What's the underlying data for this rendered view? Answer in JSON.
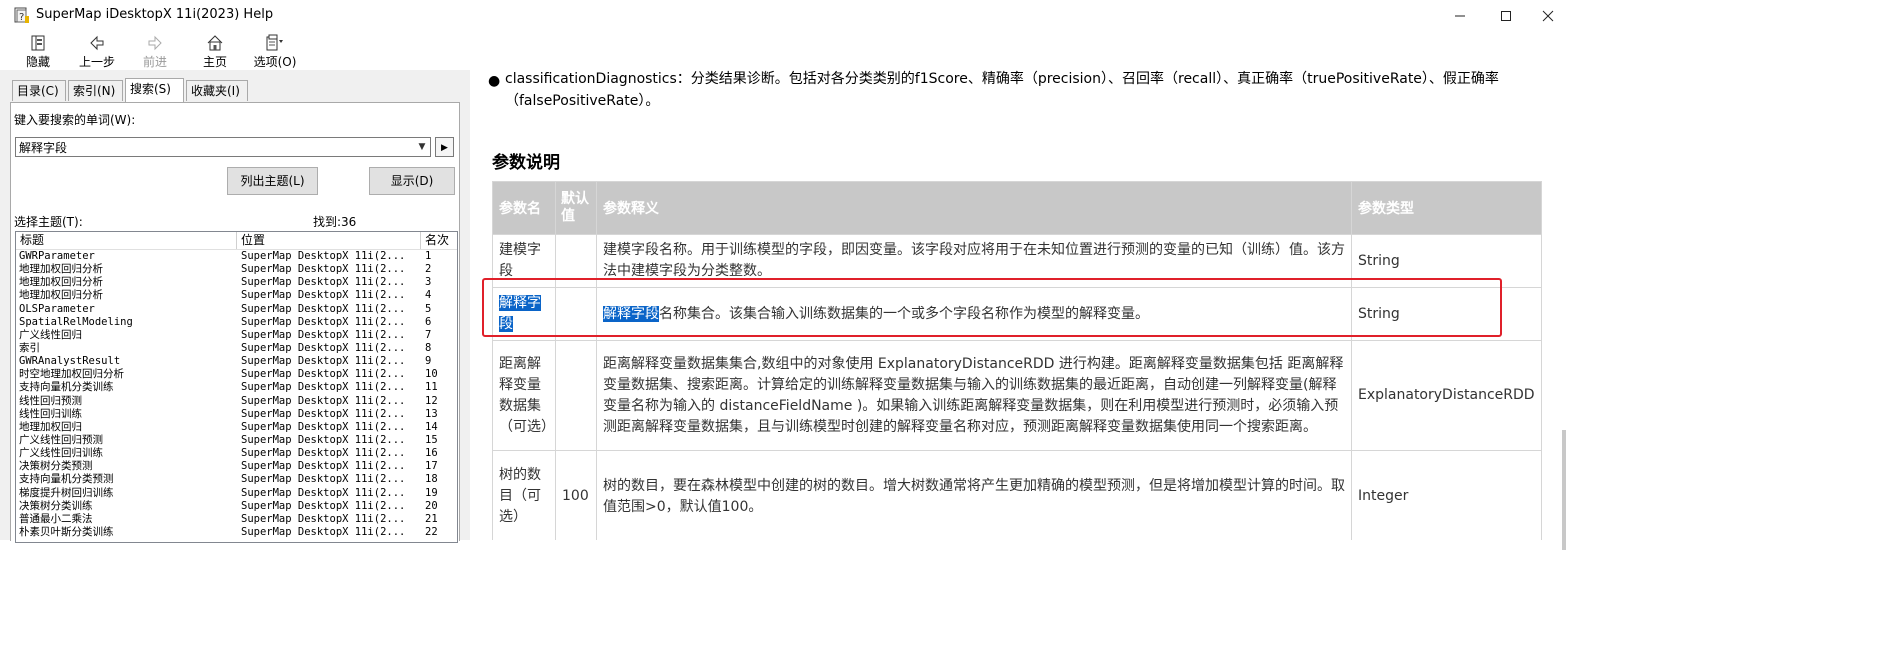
{
  "window": {
    "title": "SuperMap iDesktopX 11i(2023) Help"
  },
  "toolbar": {
    "hide": "隐藏",
    "back": "上一步",
    "forward": "前进",
    "home": "主页",
    "options": "选项(O)"
  },
  "tabs": [
    "目录(C)",
    "索引(N)",
    "搜索(S)",
    "收藏夹(I)"
  ],
  "search": {
    "prompt": "键入要搜索的单词(W):",
    "value": "解释字段",
    "list_topics_button": "列出主题(L)",
    "display_button": "显示(D)",
    "select_topic_label": "选择主题(T):",
    "found_label": "找到:36"
  },
  "results": {
    "columns": [
      "标题",
      "位置",
      "名次"
    ],
    "rows": [
      {
        "title": "GWRParameter",
        "location": "SuperMap DesktopX 11i(2...",
        "rank": "1"
      },
      {
        "title": "地理加权回归分析",
        "location": "SuperMap DesktopX 11i(2...",
        "rank": "2"
      },
      {
        "title": "地理加权回归分析",
        "location": "SuperMap DesktopX 11i(2...",
        "rank": "3"
      },
      {
        "title": "地理加权回归分析",
        "location": "SuperMap DesktopX 11i(2...",
        "rank": "4"
      },
      {
        "title": "OLSParameter",
        "location": "SuperMap DesktopX 11i(2...",
        "rank": "5"
      },
      {
        "title": "SpatialRelModeling",
        "location": "SuperMap DesktopX 11i(2...",
        "rank": "6"
      },
      {
        "title": "广义线性回归",
        "location": "SuperMap DesktopX 11i(2...",
        "rank": "7"
      },
      {
        "title": "索引",
        "location": "SuperMap DesktopX 11i(2...",
        "rank": "8"
      },
      {
        "title": "GWRAnalystResult",
        "location": "SuperMap DesktopX 11i(2...",
        "rank": "9"
      },
      {
        "title": "时空地理加权回归分析",
        "location": "SuperMap DesktopX 11i(2...",
        "rank": "10"
      },
      {
        "title": "支持向量机分类训练",
        "location": "SuperMap DesktopX 11i(2...",
        "rank": "11"
      },
      {
        "title": "线性回归预测",
        "location": "SuperMap DesktopX 11i(2...",
        "rank": "12"
      },
      {
        "title": "线性回归训练",
        "location": "SuperMap DesktopX 11i(2...",
        "rank": "13"
      },
      {
        "title": "地理加权回归",
        "location": "SuperMap DesktopX 11i(2...",
        "rank": "14"
      },
      {
        "title": "广义线性回归预测",
        "location": "SuperMap DesktopX 11i(2...",
        "rank": "15"
      },
      {
        "title": "广义线性回归训练",
        "location": "SuperMap DesktopX 11i(2...",
        "rank": "16"
      },
      {
        "title": "决策树分类预测",
        "location": "SuperMap DesktopX 11i(2...",
        "rank": "17"
      },
      {
        "title": "支持向量机分类预测",
        "location": "SuperMap DesktopX 11i(2...",
        "rank": "18"
      },
      {
        "title": "梯度提升树回归训练",
        "location": "SuperMap DesktopX 11i(2...",
        "rank": "19"
      },
      {
        "title": "决策树分类训练",
        "location": "SuperMap DesktopX 11i(2...",
        "rank": "20"
      },
      {
        "title": "普通最小二乘法",
        "location": "SuperMap DesktopX 11i(2...",
        "rank": "21"
      },
      {
        "title": "朴素贝叶斯分类训练",
        "location": "SuperMap DesktopX 11i(2...",
        "rank": "22"
      }
    ]
  },
  "doc": {
    "bullet_text": "classificationDiagnostics：分类结果诊断。包括对各分类类别的f1Score、精确率（precision）、召回率（recall）、真正确率（truePositiveRate）、假正确率（falsePositiveRate）。",
    "section_title": "参数说明",
    "table_headers": [
      "参数名",
      "默认值",
      "参数释义",
      "参数类型"
    ],
    "rows": [
      {
        "name": "建模字段",
        "default": "",
        "desc": "建模字段名称。用于训练模型的字段，即因变量。该字段对应将用于在未知位置进行预测的变量的已知（训练）值。该方法中建模字段为分类整数。",
        "type": "String"
      },
      {
        "name": "解释字段",
        "default": "",
        "desc_highlight": "解释字段",
        "desc": "名称集合。该集合输入训练数据集的一个或多个字段名称作为模型的解释变量。",
        "type": "String"
      },
      {
        "name": "距离解释变量数据集（可选）",
        "default": "",
        "desc": "距离解释变量数据集集合,数组中的对象使用 ExplanatoryDistanceRDD 进行构建。距离解释变量数据集包括 距离解释变量数据集、搜索距离。计算给定的训练解释变量数据集与输入的训练数据集的最近距离，自动创建一列解释变量(解释变量名称为输入的 distanceFieldName )。如果输入训练距离解释变量数据集，则在利用模型进行预测时，必须输入预测距离解释变量数据集，且与训练模型时创建的解释变量名称对应，预测距离解释变量数据集使用同一个搜索距离。",
        "type": "ExplanatoryDistanceRDD"
      },
      {
        "name": "树的数目（可选）",
        "default": "100",
        "desc": "树的数目，要在森林模型中创建的树的数目。增大树数通常将产生更加精确的模型预测，但是将增加模型计算的时间。取值范围>0，默认值100。",
        "type": "Integer"
      }
    ]
  }
}
